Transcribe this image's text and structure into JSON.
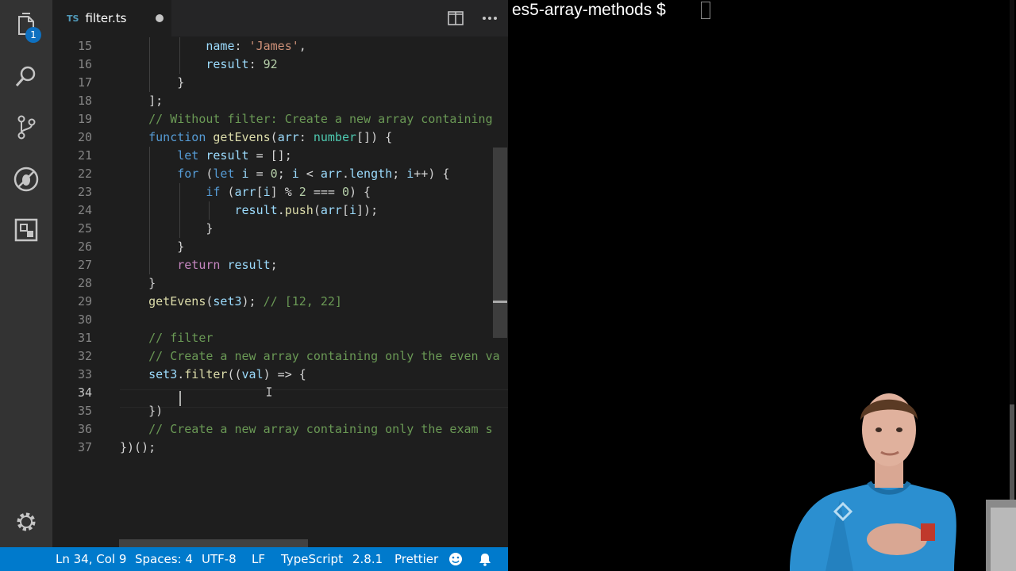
{
  "editor": {
    "activity": {
      "badge": "1",
      "icons": [
        "files-icon",
        "search-icon",
        "source-control-icon",
        "debug-icon",
        "extensions-icon",
        "gear-icon"
      ]
    },
    "tab": {
      "lang": "TS",
      "filename": "filter.ts"
    },
    "code": {
      "cursor_line": "34",
      "lines": [
        {
          "n": "15",
          "text": "            name: 'James',"
        },
        {
          "n": "16",
          "text": "            result: 92"
        },
        {
          "n": "17",
          "text": "        }"
        },
        {
          "n": "18",
          "text": "    ];"
        },
        {
          "n": "19",
          "text": "    // Without filter: Create a new array containing"
        },
        {
          "n": "20",
          "text": "    function getEvens(arr: number[]) {"
        },
        {
          "n": "21",
          "text": "        let result = [];"
        },
        {
          "n": "22",
          "text": "        for (let i = 0; i < arr.length; i++) {"
        },
        {
          "n": "23",
          "text": "            if (arr[i] % 2 === 0) {"
        },
        {
          "n": "24",
          "text": "                result.push(arr[i]);"
        },
        {
          "n": "25",
          "text": "            }"
        },
        {
          "n": "26",
          "text": "        }"
        },
        {
          "n": "27",
          "text": "        return result;"
        },
        {
          "n": "28",
          "text": "    }"
        },
        {
          "n": "29",
          "text": "    getEvens(set3); // [12, 22]"
        },
        {
          "n": "30",
          "text": ""
        },
        {
          "n": "31",
          "text": "    // filter"
        },
        {
          "n": "32",
          "text": "    // Create a new array containing only the even va"
        },
        {
          "n": "33",
          "text": "    set3.filter((val) => {"
        },
        {
          "n": "34",
          "text": ""
        },
        {
          "n": "35",
          "text": "    })"
        },
        {
          "n": "36",
          "text": "    // Create a new array containing only the exam s"
        },
        {
          "n": "37",
          "text": "})();"
        }
      ]
    },
    "status": {
      "position": "Ln 34, Col 9",
      "spaces": "Spaces: 4",
      "encoding": "UTF-8",
      "eol": "LF",
      "language": "TypeScript",
      "ts_version": "2.8.1",
      "formatter": "Prettier"
    }
  },
  "terminal": {
    "prompt": "es5-array-methods $"
  },
  "colors": {
    "editor_bg": "#1e1e1e",
    "activity_bg": "#333333",
    "status_bg": "#007acc",
    "terminal_bg": "#000000",
    "keyword": "#569cd6",
    "comment": "#6a9955",
    "string": "#ce9178",
    "number": "#b5cea8",
    "function": "#dcdcaa"
  }
}
